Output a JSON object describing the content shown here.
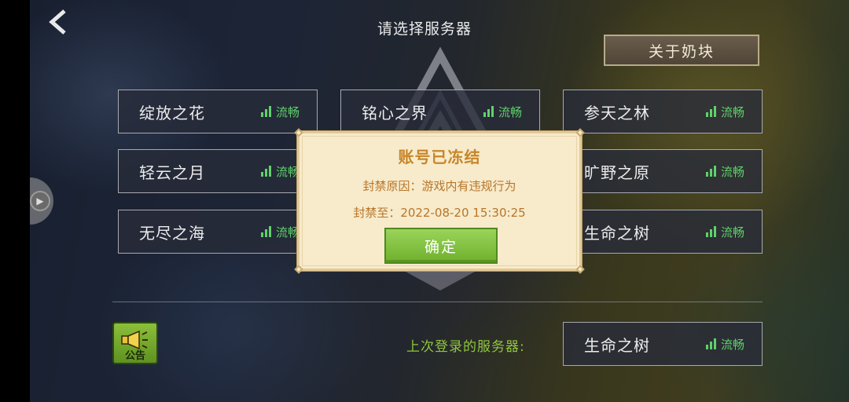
{
  "header": {
    "title": "请选择服务器",
    "back_icon": "back-chevron-icon",
    "about_label": "关于奶块"
  },
  "servers": [
    {
      "name": "绽放之花",
      "status": "流畅"
    },
    {
      "name": "铭心之界",
      "status": "流畅"
    },
    {
      "name": "参天之林",
      "status": "流畅"
    },
    {
      "name": "轻云之月",
      "status": "流畅"
    },
    {
      "name": "旷野之原",
      "status": "流畅"
    },
    {
      "name": "无尽之海",
      "status": "流畅"
    },
    {
      "name": "生命之树",
      "status": "流畅"
    }
  ],
  "footer": {
    "notice_label": "公告",
    "last_label": "上次登录的服务器:",
    "last_server": {
      "name": "生命之树",
      "status": "流畅"
    }
  },
  "modal": {
    "title": "账号已冻结",
    "reason": "封禁原因：游戏内有违规行为",
    "until": "封禁至：2022-08-20 15:30:25",
    "ok_label": "确定"
  },
  "colors": {
    "status_green": "#5fd26a",
    "modal_bg": "#f7ebcb",
    "modal_title": "#c8862a",
    "ok_green": "#7dbf3a",
    "last_label": "#8fc83c"
  }
}
